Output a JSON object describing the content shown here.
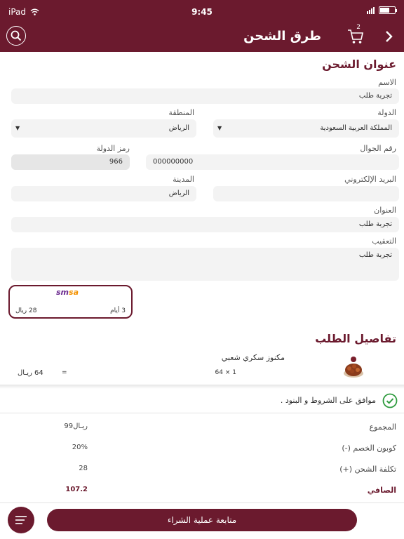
{
  "status_bar": {
    "device": "iPad",
    "time": "9:45"
  },
  "nav": {
    "title": "طرق الشحن",
    "cart_count": "2"
  },
  "form": {
    "section_title": "عنوان الشحن",
    "name": {
      "label": "الاسم",
      "value": "تجربة طلب"
    },
    "country": {
      "label": "الدولة",
      "value": "المملكة العربية السعودية"
    },
    "region": {
      "label": "المنطقة",
      "value": "الرياض"
    },
    "phone": {
      "label": "رقم الجوال",
      "value": "000000000"
    },
    "country_code": {
      "label": "رمز الدولة",
      "value": "966"
    },
    "email": {
      "label": "البريد الإلكتروني",
      "value": ""
    },
    "city": {
      "label": "المدينة",
      "value": "الرياض"
    },
    "address": {
      "label": "العنوان",
      "value": "تجربة طلب"
    },
    "notes": {
      "label": "التعقيب",
      "value": "تجربة طلب"
    }
  },
  "shipping": {
    "logo": "smsa",
    "days": "3 أيام",
    "price": "28 ريال"
  },
  "order": {
    "title": "تفاصيل الطلب",
    "product_name": "مكنوز سكري شعبي",
    "qty": "64 × 1",
    "eq": "=",
    "total": "64 ريـال"
  },
  "terms": {
    "text": "موافق على الشروط و البنود ."
  },
  "summary": {
    "subtotal_label": "المجموع",
    "subtotal_value": "99ريـال",
    "coupon_label": "كوبون الخصم (-)",
    "coupon_value": "20%",
    "shipping_label": "تكلفة الشحن (+)",
    "shipping_value": "28",
    "net_label": "الصافي",
    "net_value": "107.2"
  },
  "checkout": {
    "label": "متابعة عملية الشراء"
  },
  "colors": {
    "primary": "#6b1a2e",
    "check": "#2e9b3e",
    "smsa_purple": "#6b2a8f",
    "smsa_orange": "#f39200"
  }
}
